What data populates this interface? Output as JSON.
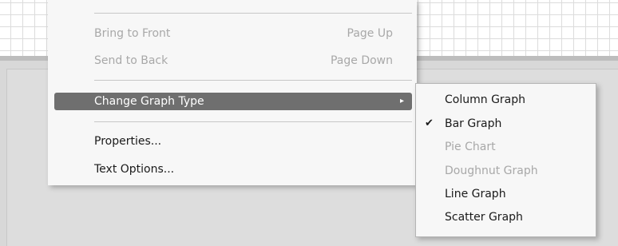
{
  "context_menu": {
    "items": [
      {
        "label": "Bring to Front",
        "shortcut": "Page Up",
        "enabled": false
      },
      {
        "label": "Send to Back",
        "shortcut": "Page Down",
        "enabled": false
      },
      {
        "label": "Change Graph Type",
        "shortcut": "",
        "enabled": true,
        "highlighted": true,
        "has_submenu": true
      },
      {
        "label": "Properties...",
        "shortcut": "",
        "enabled": true
      },
      {
        "label": "Text Options...",
        "shortcut": "",
        "enabled": true
      }
    ]
  },
  "submenu": {
    "items": [
      {
        "label": "Column Graph",
        "enabled": true,
        "checked": false
      },
      {
        "label": "Bar Graph",
        "enabled": true,
        "checked": true
      },
      {
        "label": "Pie Chart",
        "enabled": false,
        "checked": false
      },
      {
        "label": "Doughnut Graph",
        "enabled": false,
        "checked": false
      },
      {
        "label": "Line Graph",
        "enabled": true,
        "checked": false
      },
      {
        "label": "Scatter Graph",
        "enabled": true,
        "checked": false
      }
    ]
  },
  "icons": {
    "submenu_arrow": "chevron-right-icon",
    "check": "checkmark-icon"
  },
  "colors": {
    "highlight": "#6f6f6f",
    "menu_bg": "#f7f7f7",
    "disabled_text": "#a8a8a8"
  }
}
